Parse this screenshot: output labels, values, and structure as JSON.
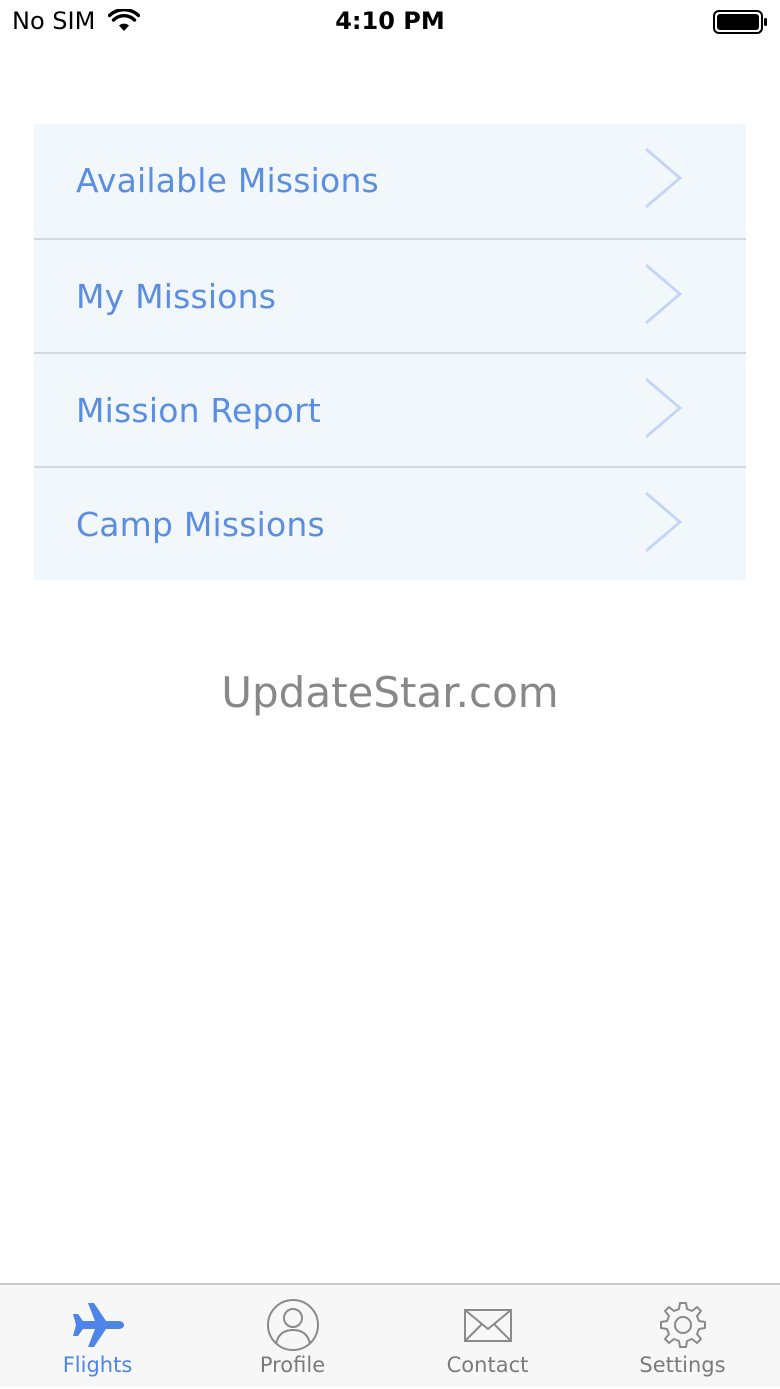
{
  "status_bar": {
    "carrier": "No SIM",
    "time": "4:10 PM",
    "wifi_icon": "wifi-icon",
    "battery_icon": "battery-full-icon"
  },
  "menu": {
    "items": [
      {
        "label": "Available Missions",
        "icon": "chevron-right-icon"
      },
      {
        "label": "My Missions",
        "icon": "chevron-right-icon"
      },
      {
        "label": "Mission Report",
        "icon": "chevron-right-icon"
      },
      {
        "label": "Camp Missions",
        "icon": "chevron-right-icon"
      }
    ]
  },
  "watermark": "UpdateStar.com",
  "tab_bar": {
    "tabs": [
      {
        "label": "Flights",
        "icon": "airplane-icon",
        "active": true
      },
      {
        "label": "Profile",
        "icon": "user-circle-icon",
        "active": false
      },
      {
        "label": "Contact",
        "icon": "envelope-icon",
        "active": false
      },
      {
        "label": "Settings",
        "icon": "gear-icon",
        "active": false
      }
    ]
  },
  "colors": {
    "accent": "#4d85e8",
    "menu_text": "#5b8ee0",
    "menu_background": "#f2f7fc",
    "inactive_tab": "#7b7b7b",
    "watermark": "#888888"
  }
}
